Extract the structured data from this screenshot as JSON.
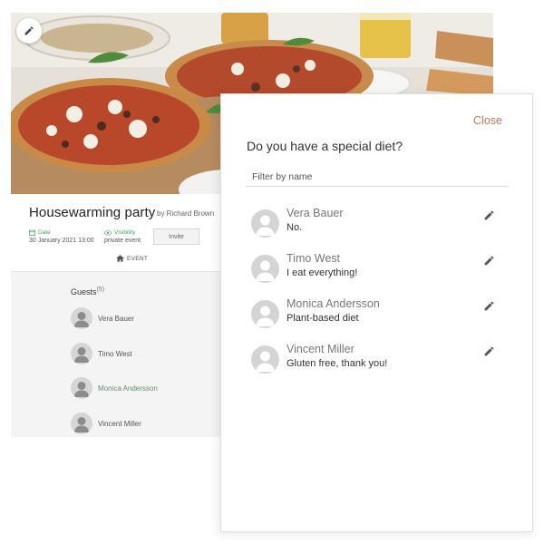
{
  "event": {
    "title": "Housewarming party",
    "host": "by Richard Brown",
    "date_label": "Date",
    "date_value": "30 January 2021 13:00",
    "visibility_label": "Visibility",
    "visibility_value": "private event",
    "invite_label": "Invite",
    "tab_label": "EVENT",
    "guests_label": "Guests",
    "guests_count": "(5)",
    "guests": [
      {
        "name": "Vera Bauer"
      },
      {
        "name": "Timo West"
      },
      {
        "name": "Monica Andersson"
      },
      {
        "name": "Vincent Miller"
      }
    ]
  },
  "dialog": {
    "close_label": "Close",
    "title": "Do you have a special diet?",
    "filter_placeholder": "Filter by name",
    "entries": [
      {
        "name": "Vera Bauer",
        "note": "No."
      },
      {
        "name": "Timo West",
        "note": "I eat everything!"
      },
      {
        "name": "Monica Andersson",
        "note": "Plant-based diet"
      },
      {
        "name": "Vincent Miller",
        "note": "Gluten free, thank you!"
      }
    ]
  },
  "icons": {
    "edit_photo": "pencil-icon",
    "date": "calendar-icon",
    "visibility": "eye-icon",
    "event_tab": "home-icon",
    "avatar": "person-icon",
    "edit_diet": "pencil-icon"
  },
  "colors": {
    "accent_close": "#b07a62",
    "meta_green": "#4f9a68",
    "avatar_gray": "#d4d4d4"
  }
}
